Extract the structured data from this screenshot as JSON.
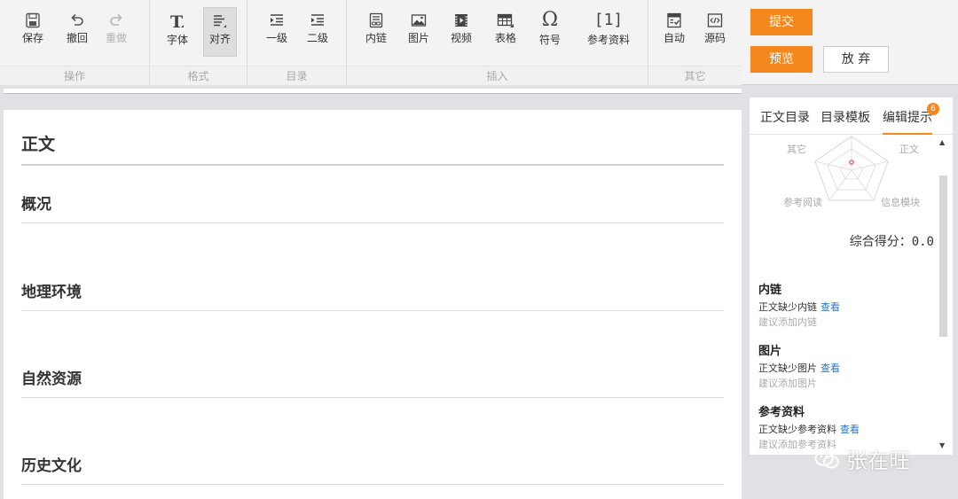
{
  "toolbar": {
    "groups": {
      "operate": {
        "label": "操作",
        "save": "保存",
        "undo": "撤回",
        "redo": "重做"
      },
      "format": {
        "label": "格式",
        "font": "字体",
        "align": "对齐"
      },
      "toc": {
        "label": "目录",
        "level1": "一级",
        "level2": "二级"
      },
      "insert": {
        "label": "插入",
        "link": "内链",
        "image": "图片",
        "video": "视频",
        "table": "表格",
        "symbol": "符号",
        "reference": "参考资料",
        "reference_glyph": "[1]",
        "symbol_glyph": "Ω",
        "font_glyph": "T"
      },
      "other": {
        "label": "其它",
        "auto": "自动",
        "source": "源码"
      }
    }
  },
  "actions": {
    "submit": "提交",
    "preview": "预览",
    "discard": "放 弃"
  },
  "editor": {
    "headings": [
      "正文",
      "概况",
      "地理环境",
      "自然资源",
      "历史文化"
    ]
  },
  "panel": {
    "tabs": [
      "正文目录",
      "目录模板",
      "编辑提示"
    ],
    "badge": "6",
    "radar": {
      "labels": [
        "其它",
        "正文",
        "参考阅读",
        "信息模块"
      ]
    },
    "score_label": "综合得分：",
    "score_value": "0.0",
    "tips": [
      {
        "title": "内链",
        "desc": "正文缺少内链",
        "link": "查看",
        "sub": "建议添加内链"
      },
      {
        "title": "图片",
        "desc": "正文缺少图片",
        "link": "查看",
        "sub": "建议添加图片"
      },
      {
        "title": "参考资料",
        "desc": "正文缺少参考资料",
        "link": "查看",
        "sub": "建议添加参考资料"
      }
    ]
  },
  "watermark": "张在旺",
  "colors": {
    "accent": "#f5871f",
    "link": "#2a74c7"
  }
}
